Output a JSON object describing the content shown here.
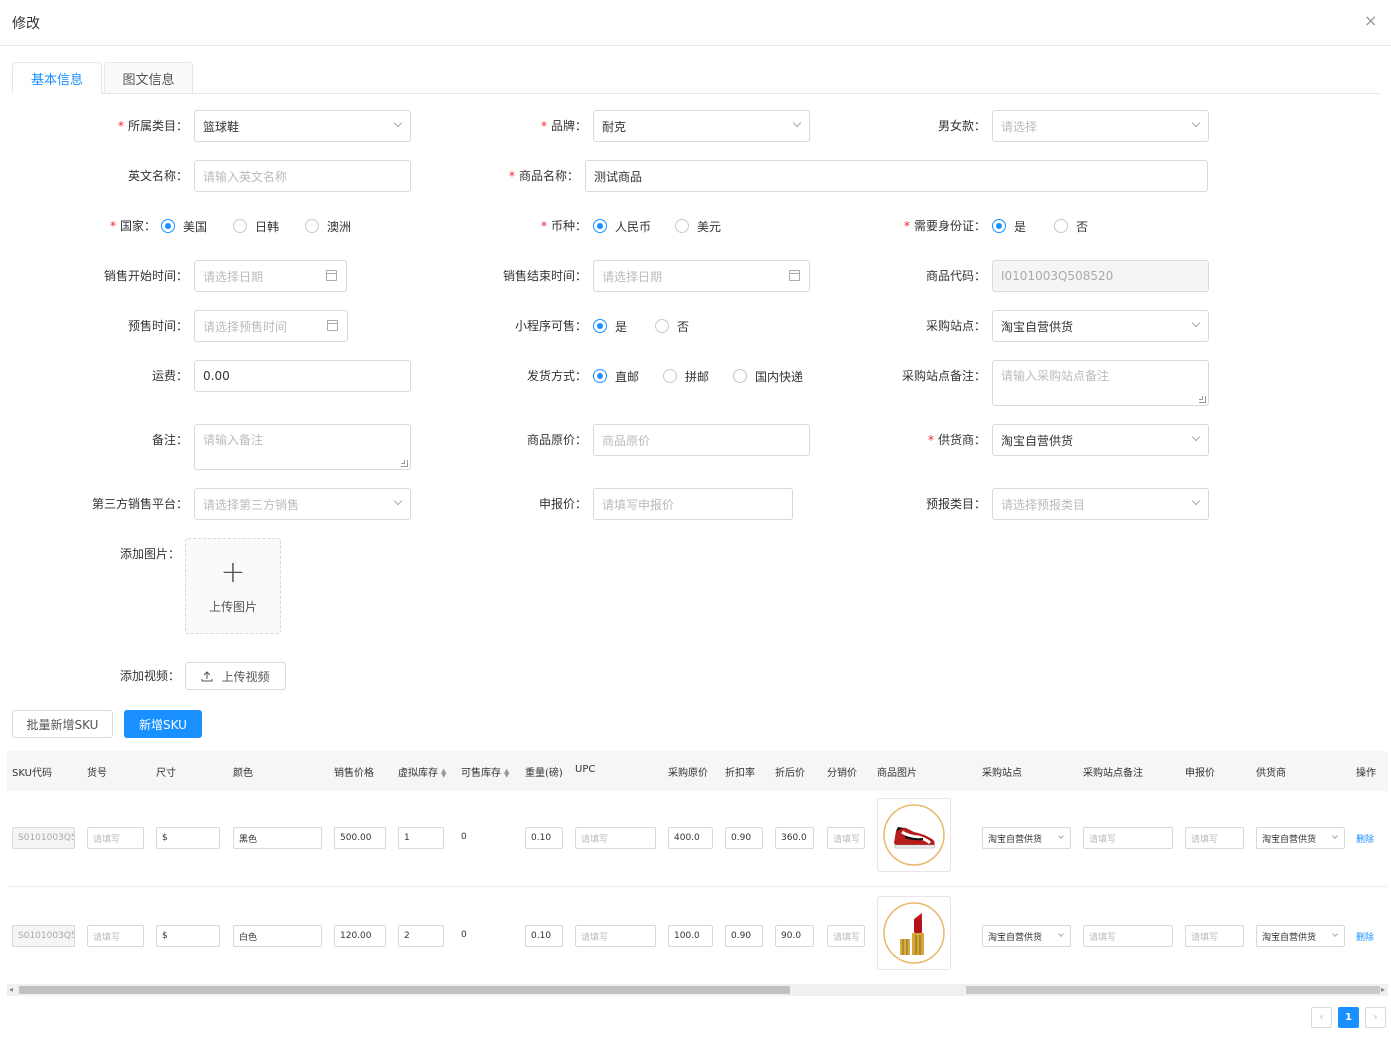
{
  "dialog": {
    "title": "修改",
    "close": "×"
  },
  "tabs": [
    {
      "label": "基本信息"
    },
    {
      "label": "图文信息"
    }
  ],
  "form": {
    "category": {
      "label": "所属类目",
      "value": "篮球鞋"
    },
    "brand": {
      "label": "品牌",
      "value": "耐克"
    },
    "gender": {
      "label": "男女款",
      "placeholder": "请选择"
    },
    "english_name": {
      "label": "英文名称",
      "placeholder": "请输入英文名称"
    },
    "product_name": {
      "label": "商品名称",
      "value": "测试商品"
    },
    "country": {
      "label": "国家",
      "options": [
        "美国",
        "日韩",
        "澳洲"
      ],
      "selected": "美国"
    },
    "currency": {
      "label": "币种",
      "options": [
        "人民币",
        "美元"
      ],
      "selected": "人民币"
    },
    "id_required": {
      "label": "需要身份证",
      "options": [
        "是",
        "否"
      ],
      "selected": "是"
    },
    "sale_start": {
      "label": "销售开始时间",
      "placeholder": "请选择日期"
    },
    "sale_end": {
      "label": "销售结束时间",
      "placeholder": "请选择日期"
    },
    "product_code": {
      "label": "商品代码",
      "value": "I0101003Q508520"
    },
    "presale_time": {
      "label": "预售时间",
      "placeholder": "请选择预售时间"
    },
    "miniprogram": {
      "label": "小程序可售",
      "options": [
        "是",
        "否"
      ],
      "selected": "是"
    },
    "purchase_site": {
      "label": "采购站点",
      "value": "淘宝自营供货"
    },
    "shipping_fee": {
      "label": "运费",
      "value": "0.00"
    },
    "delivery": {
      "label": "发货方式",
      "options": [
        "直邮",
        "拼邮",
        "国内快递"
      ],
      "selected": "直邮"
    },
    "site_note": {
      "label": "采购站点备注",
      "placeholder": "请输入采购站点备注"
    },
    "remark": {
      "label": "备注",
      "placeholder": "请输入备注"
    },
    "orig_price": {
      "label": "商品原价",
      "placeholder": "商品原价"
    },
    "supplier": {
      "label": "供货商",
      "value": "淘宝自营供货"
    },
    "third_party": {
      "label": "第三方销售平台",
      "placeholder": "请选择第三方销售"
    },
    "declared_price": {
      "label": "申报价",
      "placeholder": "请填写申报价"
    },
    "declared_category": {
      "label": "预报类目",
      "placeholder": "请选择预报类目"
    },
    "add_image": {
      "label": "添加图片",
      "button": "上传图片",
      "plus": "+"
    },
    "add_video": {
      "label": "添加视频",
      "button": "上传视频"
    }
  },
  "actions": {
    "batch_add": "批量新增SKU",
    "add_sku": "新增SKU"
  },
  "table": {
    "headers": [
      "SKU代码",
      "货号",
      "尺寸",
      "颜色",
      "销售价格",
      "虚拟库存",
      "可售库存",
      "重量(磅)",
      "UPC",
      "采购原价",
      "折扣率",
      "折后价",
      "分销价",
      "商品图片",
      "采购站点",
      "采购站点备注",
      "申报价",
      "供货商",
      "操作"
    ],
    "placeholder": "请填写",
    "rows": [
      {
        "sku": "S0101003Q5",
        "size": "$",
        "color": "黑色",
        "price": "500.00",
        "virtual_stock": "1",
        "sellable": "0",
        "weight": "0.10",
        "orig": "400.0",
        "discount": "0.90",
        "after": "360.0",
        "site": "淘宝自营供货",
        "supplier": "淘宝自营供货",
        "action": "删除",
        "image": "sneaker-icon"
      },
      {
        "sku": "S0101003Q5",
        "size": "$",
        "color": "白色",
        "price": "120.00",
        "virtual_stock": "2",
        "sellable": "0",
        "weight": "0.10",
        "orig": "100.0",
        "discount": "0.90",
        "after": "90.0",
        "site": "淘宝自营供货",
        "supplier": "淘宝自营供货",
        "action": "删除",
        "image": "lipstick-icon"
      }
    ]
  },
  "pagination": {
    "current": "1",
    "prev": "‹",
    "next": "›"
  },
  "colors": {
    "primary": "#1890ff",
    "required": "#f5222d",
    "border": "#d9d9d9"
  }
}
